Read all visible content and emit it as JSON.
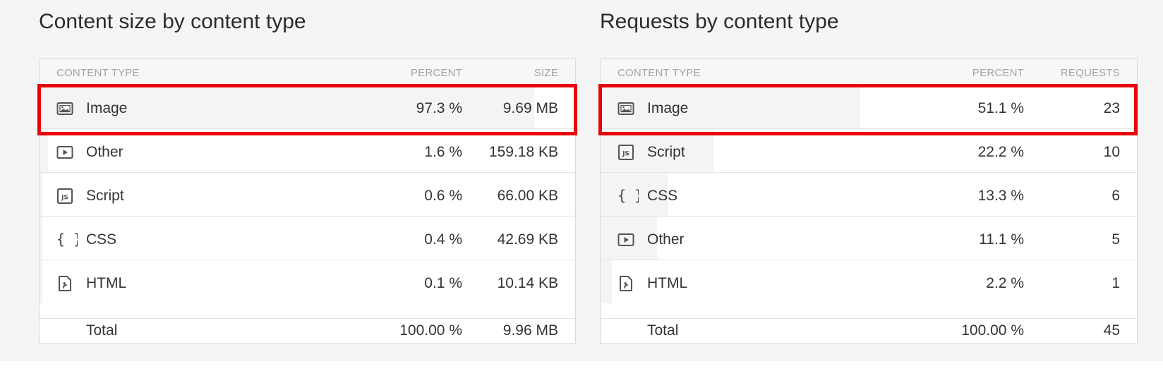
{
  "left_panel": {
    "title": "Content size by content type",
    "headers": {
      "type": "CONTENT TYPE",
      "percent": "PERCENT",
      "value": "SIZE"
    },
    "rows": [
      {
        "label": "Image",
        "percent": "97.3 %",
        "value": "9.69 MB",
        "icon": "image-icon",
        "share": 0.973
      },
      {
        "label": "Other",
        "percent": "1.6 %",
        "value": "159.18 KB",
        "icon": "video-play-icon",
        "share": 0.016
      },
      {
        "label": "Script",
        "percent": "0.6 %",
        "value": "66.00 KB",
        "icon": "js-file-icon",
        "share": 0.006
      },
      {
        "label": "CSS",
        "percent": "0.4 %",
        "value": "42.69 KB",
        "icon": "curly-braces-icon",
        "share": 0.004
      },
      {
        "label": "HTML",
        "percent": "0.1 %",
        "value": "10.14 KB",
        "icon": "html-file-icon",
        "share": 0.001
      }
    ],
    "total": {
      "label": "Total",
      "percent": "100.00 %",
      "value": "9.96 MB"
    }
  },
  "right_panel": {
    "title": "Requests by content type",
    "headers": {
      "type": "CONTENT TYPE",
      "percent": "PERCENT",
      "value": "REQUESTS"
    },
    "rows": [
      {
        "label": "Image",
        "percent": "51.1 %",
        "value": "23",
        "icon": "image-icon",
        "share": 0.511
      },
      {
        "label": "Script",
        "percent": "22.2 %",
        "value": "10",
        "icon": "js-file-icon",
        "share": 0.222
      },
      {
        "label": "CSS",
        "percent": "13.3 %",
        "value": "6",
        "icon": "curly-braces-icon",
        "share": 0.133
      },
      {
        "label": "Other",
        "percent": "11.1 %",
        "value": "5",
        "icon": "video-play-icon",
        "share": 0.111
      },
      {
        "label": "HTML",
        "percent": "2.2 %",
        "value": "1",
        "icon": "html-file-icon",
        "share": 0.022
      }
    ],
    "total": {
      "label": "Total",
      "percent": "100.00 %",
      "value": "45"
    }
  },
  "colors": {
    "highlight": "#e8000c",
    "bar": "#f4f4f4",
    "border": "#d9d9d9",
    "header_text": "#a3a3a3"
  }
}
